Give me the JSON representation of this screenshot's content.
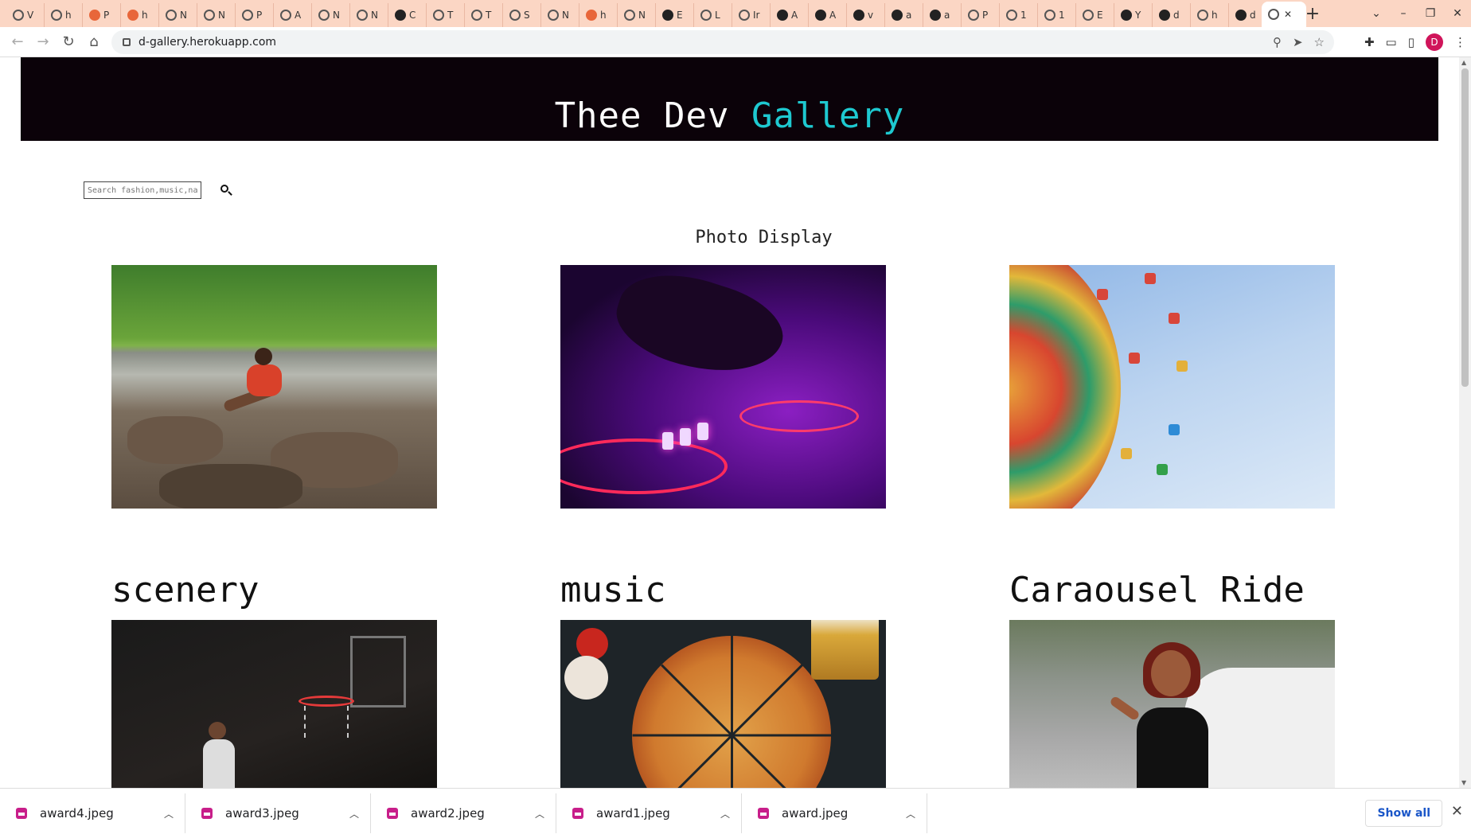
{
  "browser": {
    "tabs": [
      {
        "label": "V",
        "icon": "plant-icon"
      },
      {
        "label": "h",
        "icon": "globe-icon"
      },
      {
        "label": "P",
        "icon": "postman-icon"
      },
      {
        "label": "h",
        "icon": "postman-icon"
      },
      {
        "label": "N",
        "icon": "globe-icon"
      },
      {
        "label": "N",
        "icon": "calendar-icon"
      },
      {
        "label": "P",
        "icon": "plant-icon"
      },
      {
        "label": "A",
        "icon": "w-icon"
      },
      {
        "label": "N",
        "icon": "globe-icon"
      },
      {
        "label": "N",
        "icon": "globe-icon"
      },
      {
        "label": "C",
        "icon": "github-icon"
      },
      {
        "label": "T",
        "icon": "globe-icon"
      },
      {
        "label": "T",
        "icon": "globe-icon"
      },
      {
        "label": "S",
        "icon": "globe-icon"
      },
      {
        "label": "N",
        "icon": "globe-icon"
      },
      {
        "label": "h",
        "icon": "postman-icon"
      },
      {
        "label": "N",
        "icon": "globe-icon"
      },
      {
        "label": "E",
        "icon": "github-icon"
      },
      {
        "label": "L",
        "icon": "globe-icon"
      },
      {
        "label": "Ir",
        "icon": "globe-icon"
      },
      {
        "label": "A",
        "icon": "github-icon"
      },
      {
        "label": "A",
        "icon": "github-icon"
      },
      {
        "label": "v",
        "icon": "github-icon"
      },
      {
        "label": "a",
        "icon": "github-icon"
      },
      {
        "label": "a",
        "icon": "github-icon"
      },
      {
        "label": "P",
        "icon": "globe-icon"
      },
      {
        "label": "1",
        "icon": "globe-icon"
      },
      {
        "label": "1",
        "icon": "globe-icon"
      },
      {
        "label": "E",
        "icon": "briefcase-icon"
      },
      {
        "label": "Y",
        "icon": "github-icon"
      },
      {
        "label": "d",
        "icon": "github-icon"
      },
      {
        "label": "h",
        "icon": "globe-icon"
      },
      {
        "label": "d",
        "icon": "github-icon"
      }
    ],
    "url": "d-gallery.herokuapp.com",
    "profile_initial": "D",
    "newtab_label": "+"
  },
  "page": {
    "brand_main": "Thee Dev",
    "brand_accent": "Gallery",
    "search_placeholder": "Search fashion,music,na",
    "section_title": "Photo Display",
    "photos": [
      {
        "caption": "",
        "image": "scenery-photo"
      },
      {
        "caption": "",
        "image": "music-photo"
      },
      {
        "caption": "",
        "image": "carousel-photo"
      },
      {
        "caption": "scenery",
        "image": "basketball-photo"
      },
      {
        "caption": "music",
        "image": "pizza-photo"
      },
      {
        "caption": "Caraousel Ride",
        "image": "fashion-photo"
      }
    ]
  },
  "downloads": {
    "items": [
      "award4.jpeg",
      "award3.jpeg",
      "award2.jpeg",
      "award1.jpeg",
      "award.jpeg"
    ],
    "show_all": "Show all"
  },
  "colors": {
    "hero_bg": "#0b0209",
    "accent": "#1ec9d0",
    "tabstrip": "#fbd6c4"
  }
}
